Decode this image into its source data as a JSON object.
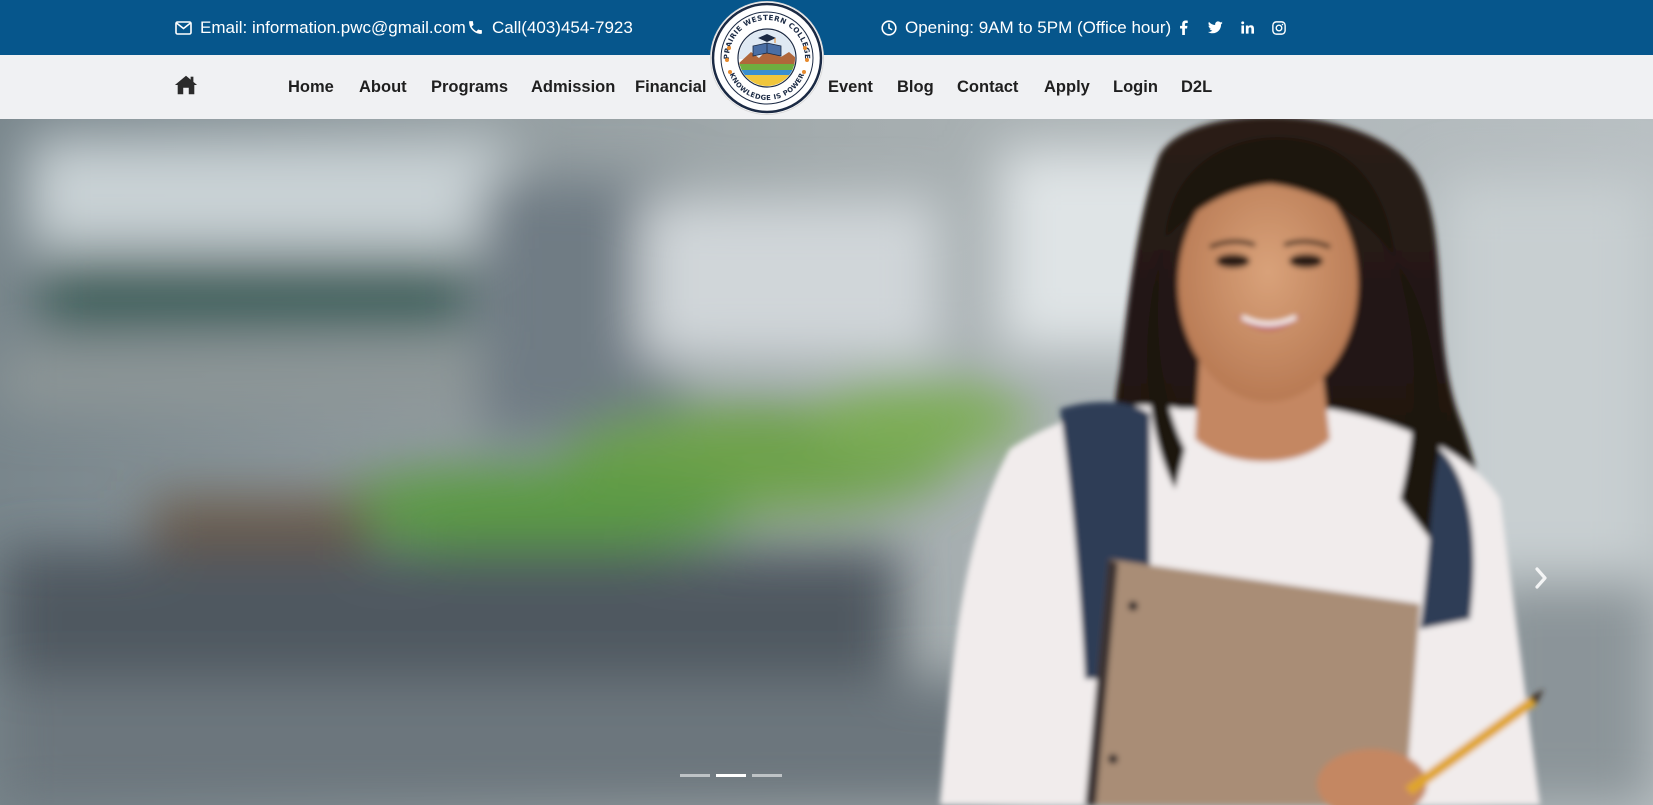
{
  "topbar": {
    "email_text": "Email: information.pwc@gmail.com",
    "phone_text": "Call(403)454-7923",
    "hours_text": "Opening: 9AM to 5PM (Office hour)",
    "social": [
      {
        "name": "facebook-icon",
        "glyph": "f"
      },
      {
        "name": "twitter-icon",
        "glyph": "t"
      },
      {
        "name": "linkedin-icon",
        "glyph": "in"
      },
      {
        "name": "instagram-icon",
        "glyph": "ig"
      }
    ],
    "background_color": "#06568c"
  },
  "logo": {
    "top_text": "PRAIRIE WESTERN COLLEGE",
    "bottom_text": "KNOWLEDGE IS POWER"
  },
  "nav": {
    "left": [
      "Home",
      "About",
      "Programs",
      "Admission",
      "Financial"
    ],
    "right": [
      "Event",
      "Blog",
      "Contact",
      "Apply",
      "Login",
      "D2L"
    ],
    "background_color": "#f0f1f3"
  },
  "hero": {
    "slide_count": 3,
    "active_slide": 2
  }
}
